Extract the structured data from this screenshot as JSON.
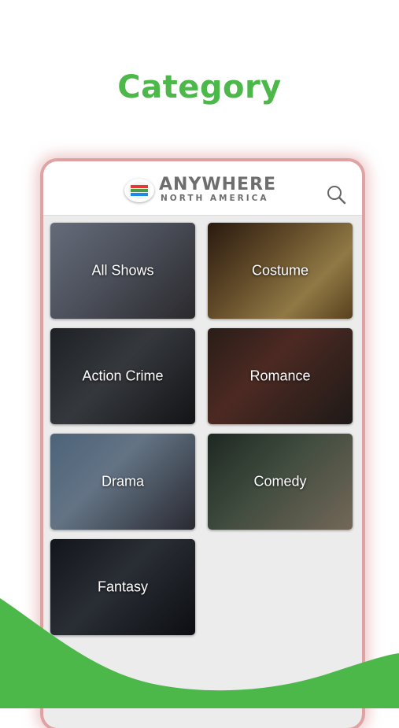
{
  "promo": {
    "headline": "Category"
  },
  "header": {
    "logo_title": "ANYWHERE",
    "logo_subtitle": "NORTH AMERICA",
    "search_icon": "search-icon"
  },
  "categories": [
    {
      "label": "All Shows"
    },
    {
      "label": "Costume"
    },
    {
      "label": "Action Crime"
    },
    {
      "label": "Romance"
    },
    {
      "label": "Drama"
    },
    {
      "label": "Comedy"
    },
    {
      "label": "Fantasy"
    }
  ],
  "colors": {
    "accent_green": "#4cb84a",
    "card_bg": "#ececec"
  }
}
